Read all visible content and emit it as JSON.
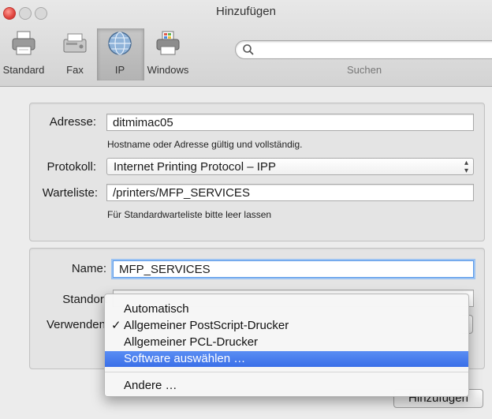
{
  "window": {
    "title": "Hinzufügen"
  },
  "toolbar": {
    "items": [
      {
        "label": "Standard",
        "icon": "printer-icon"
      },
      {
        "label": "Fax",
        "icon": "fax-icon"
      },
      {
        "label": "IP",
        "icon": "globe-icon",
        "selected": true
      },
      {
        "label": "Windows",
        "icon": "windows-printer-icon"
      }
    ],
    "search": {
      "placeholder": "",
      "label": "Suchen"
    }
  },
  "form": {
    "address_label": "Adresse:",
    "address_value": "ditmimac05",
    "address_hint": "Hostname oder Adresse gültig und vollständig.",
    "protocol_label": "Protokoll:",
    "protocol_value": "Internet Printing Protocol – IPP",
    "queue_label": "Warteliste:",
    "queue_value": "/printers/MFP_SERVICES",
    "queue_hint": "Für Standardwarteliste bitte leer lassen",
    "name_label": "Name:",
    "name_value": "MFP_SERVICES",
    "location_label": "Standort",
    "use_label": "Verwenden"
  },
  "menu": {
    "items": [
      {
        "label": "Automatisch",
        "checked": false
      },
      {
        "label": "Allgemeiner PostScript-Drucker",
        "checked": true
      },
      {
        "label": "Allgemeiner PCL-Drucker",
        "checked": false
      },
      {
        "label": "Software auswählen …",
        "checked": false,
        "highlighted": true
      },
      {
        "label": "Andere …",
        "checked": false
      }
    ],
    "check_glyph": "✓"
  },
  "buttons": {
    "add_label": "Hinzufügen"
  },
  "colors": {
    "accent": "#3a6fe8",
    "focus_ring": "#9cc3f2",
    "close": "#e0443e"
  }
}
